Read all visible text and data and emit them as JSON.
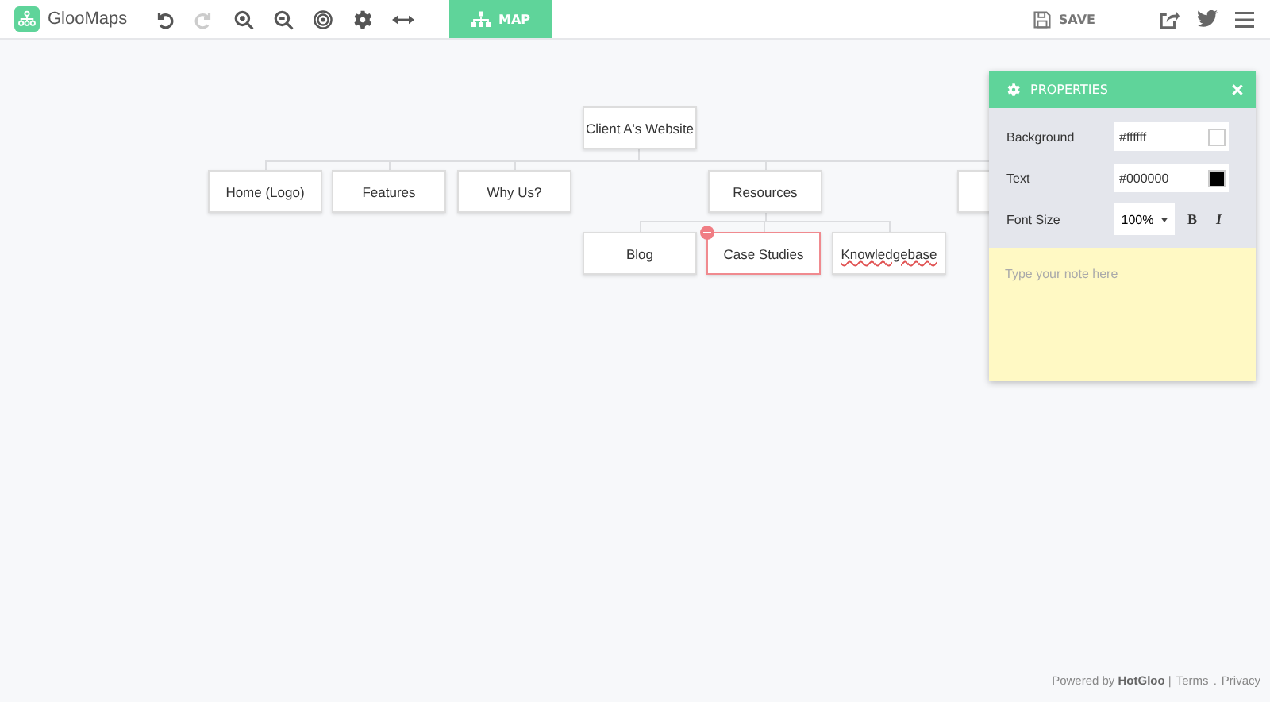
{
  "app": {
    "name": "GlooMaps"
  },
  "toolbar": {
    "tools": [
      {
        "kind": "undo",
        "disabled": false
      },
      {
        "kind": "redo",
        "disabled": true
      },
      {
        "kind": "zoom-in",
        "disabled": false
      },
      {
        "kind": "zoom-out",
        "disabled": false
      },
      {
        "kind": "target",
        "disabled": false
      },
      {
        "kind": "settings",
        "disabled": false
      },
      {
        "kind": "width",
        "disabled": false
      }
    ],
    "tabs": [
      {
        "label": "MAP",
        "selected": true
      }
    ],
    "save": {
      "label": "SAVE"
    },
    "actions": [
      {
        "kind": "share"
      },
      {
        "kind": "twitter"
      },
      {
        "kind": "menu"
      }
    ]
  },
  "map": {
    "root": {
      "label": "Client A's Website",
      "selected": false,
      "children": [
        {
          "label": "Home (Logo)",
          "selected": false
        },
        {
          "label": "Features",
          "selected": false
        },
        {
          "label": "Why Us?",
          "selected": false
        },
        {
          "label": "Resources",
          "selected": false,
          "children": [
            {
              "label": "Blog",
              "selected": false
            },
            {
              "label": "Case Studies",
              "selected": true
            },
            {
              "label": "Knowledgebase",
              "selected": false,
              "misspelled": true
            }
          ]
        },
        {
          "selected": false
        }
      ]
    }
  },
  "properties": {
    "title": "PROPERTIES",
    "fields": [
      {
        "kind": "color",
        "label": "Background",
        "value": "#ffffff"
      },
      {
        "kind": "color",
        "label": "Text",
        "value": "#000000"
      },
      {
        "kind": "font",
        "label": "Font Size",
        "value": "100%",
        "bold": "B",
        "italic": "I"
      }
    ],
    "note": {
      "placeholder": "Type your note here"
    }
  },
  "footer": {
    "credit": "Powered by **HotGloo** |",
    "links": [
      "Terms",
      "Privacy"
    ],
    "separator": "."
  }
}
